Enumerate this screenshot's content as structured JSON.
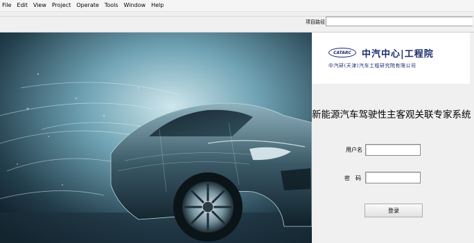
{
  "menu": [
    "File",
    "Edit",
    "View",
    "Project",
    "Operate",
    "Tools",
    "Window",
    "Help"
  ],
  "toolbar": {
    "path_label": "项目路径",
    "path_value": ""
  },
  "logo": {
    "emblem": "CATARC",
    "title": "中汽中心|工程院",
    "subtitle": "中汽研(天津)汽车工程研究院有限公司"
  },
  "system_title": "新能源汽车驾驶性主客观关联专家系统",
  "login": {
    "username_label": "用户名",
    "password_label": "密　码",
    "username": "",
    "password": "",
    "button_label": "登录"
  },
  "colors": {
    "brand": "#1b2a6b",
    "hero_dark": "#0d1b24",
    "hero_light": "#9fd0e0"
  }
}
